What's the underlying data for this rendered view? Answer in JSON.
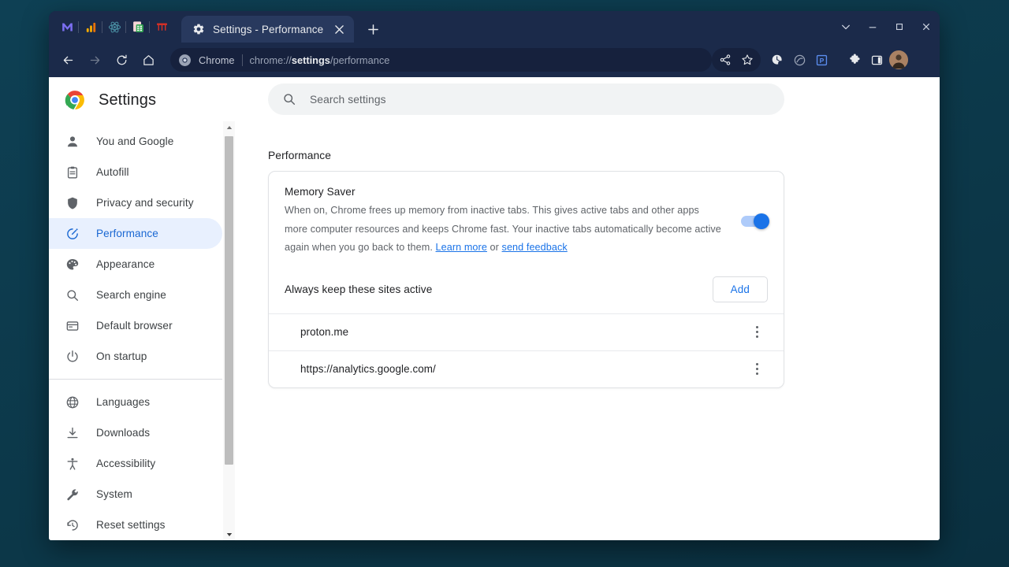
{
  "window": {
    "controls": [
      {
        "name": "tab-search-chevron",
        "label": "⌄"
      },
      {
        "name": "minimize",
        "label": "–"
      },
      {
        "name": "maximize",
        "label": "□"
      },
      {
        "name": "close",
        "label": "×"
      }
    ]
  },
  "tabstrip": {
    "pinned_tabs": [
      {
        "name": "pinned-tab-mail",
        "icon": "mail-icon",
        "color": "#7b6ef0"
      },
      {
        "name": "pinned-tab-analytics",
        "icon": "bar-chart-icon",
        "color": "#f5a623"
      },
      {
        "name": "pinned-tab-atom",
        "icon": "atom-icon",
        "color": "#4a90a4"
      },
      {
        "name": "pinned-tab-sheets",
        "icon": "spreadsheet-icon",
        "color": "#34a853"
      },
      {
        "name": "pinned-tab-calendar",
        "icon": "calendar-icon",
        "color": "#d93025"
      }
    ],
    "active_tab": {
      "title": "Settings - Performance",
      "favicon": "gear-icon",
      "close_label": "×"
    },
    "new_tab_label": "+"
  },
  "toolbar": {
    "back_label": "←",
    "forward_label": "→",
    "reload_label": "⟳",
    "home_label": "⌂",
    "omnibox": {
      "chip_icon": "chrome-icon",
      "chip_label": "Chrome",
      "url_prefix": "chrome://",
      "url_bold": "settings",
      "url_suffix": "/performance",
      "full_url": "chrome://settings/performance"
    },
    "actions": [
      {
        "name": "share-button",
        "icon": "share-icon"
      },
      {
        "name": "bookmark-button",
        "icon": "star-icon"
      }
    ],
    "extensions": [
      {
        "name": "extension-time-tracker",
        "icon": "clock-extension-icon"
      },
      {
        "name": "extension-privacy",
        "icon": "circle-slash-icon"
      },
      {
        "name": "extension-pocket",
        "icon": "p-badge-icon"
      }
    ],
    "puzzle_label": "extensions-icon",
    "side_panel_label": "side-panel-icon",
    "avatar_label": "profile-avatar",
    "menu_label": "⋮"
  },
  "settings": {
    "app_title": "Settings",
    "logo": "chrome-logo",
    "search": {
      "placeholder": "Search settings",
      "value": "",
      "icon": "search-icon"
    },
    "sidebar": {
      "groups": [
        {
          "items": [
            {
              "label": "You and Google",
              "icon": "person-icon",
              "name": "sidebar-item-you-and-google",
              "selected": false
            },
            {
              "label": "Autofill",
              "icon": "clipboard-icon",
              "name": "sidebar-item-autofill",
              "selected": false
            },
            {
              "label": "Privacy and security",
              "icon": "shield-icon",
              "name": "sidebar-item-privacy-and-security",
              "selected": false
            },
            {
              "label": "Performance",
              "icon": "speedometer-icon",
              "name": "sidebar-item-performance",
              "selected": true
            },
            {
              "label": "Appearance",
              "icon": "palette-icon",
              "name": "sidebar-item-appearance",
              "selected": false
            },
            {
              "label": "Search engine",
              "icon": "magnifier-icon",
              "name": "sidebar-item-search-engine",
              "selected": false
            },
            {
              "label": "Default browser",
              "icon": "browser-window-icon",
              "name": "sidebar-item-default-browser",
              "selected": false
            },
            {
              "label": "On startup",
              "icon": "power-icon",
              "name": "sidebar-item-on-startup",
              "selected": false
            }
          ]
        },
        {
          "items": [
            {
              "label": "Languages",
              "icon": "globe-icon",
              "name": "sidebar-item-languages",
              "selected": false
            },
            {
              "label": "Downloads",
              "icon": "download-icon",
              "name": "sidebar-item-downloads",
              "selected": false
            },
            {
              "label": "Accessibility",
              "icon": "accessibility-icon",
              "name": "sidebar-item-accessibility",
              "selected": false
            },
            {
              "label": "System",
              "icon": "wrench-icon",
              "name": "sidebar-item-system",
              "selected": false
            },
            {
              "label": "Reset settings",
              "icon": "history-restore-icon",
              "name": "sidebar-item-reset-settings",
              "selected": false
            }
          ]
        }
      ]
    },
    "page": {
      "section_title": "Performance",
      "memory_saver": {
        "title": "Memory Saver",
        "description_part1": "When on, Chrome frees up memory from inactive tabs. This gives active tabs and other apps more computer resources and keeps Chrome fast. Your inactive tabs automatically become active again when you go back to them. ",
        "learn_more": "Learn more",
        "description_part2": " or ",
        "send_feedback": "send feedback",
        "toggle_on": true
      },
      "sites": {
        "header": "Always keep these sites active",
        "add_label": "Add",
        "rows": [
          {
            "url": "proton.me"
          },
          {
            "url": "https://analytics.google.com/"
          }
        ]
      }
    }
  },
  "colors": {
    "accent_blue": "#1a73e8",
    "selected_bg": "#e8f0fe",
    "selected_text": "#1967d2",
    "toggle_track": "#aecbfa",
    "desktop_bg": "#0d3b4d",
    "window_chrome": "#1b2a4a",
    "active_tab_bg": "#28395e"
  }
}
